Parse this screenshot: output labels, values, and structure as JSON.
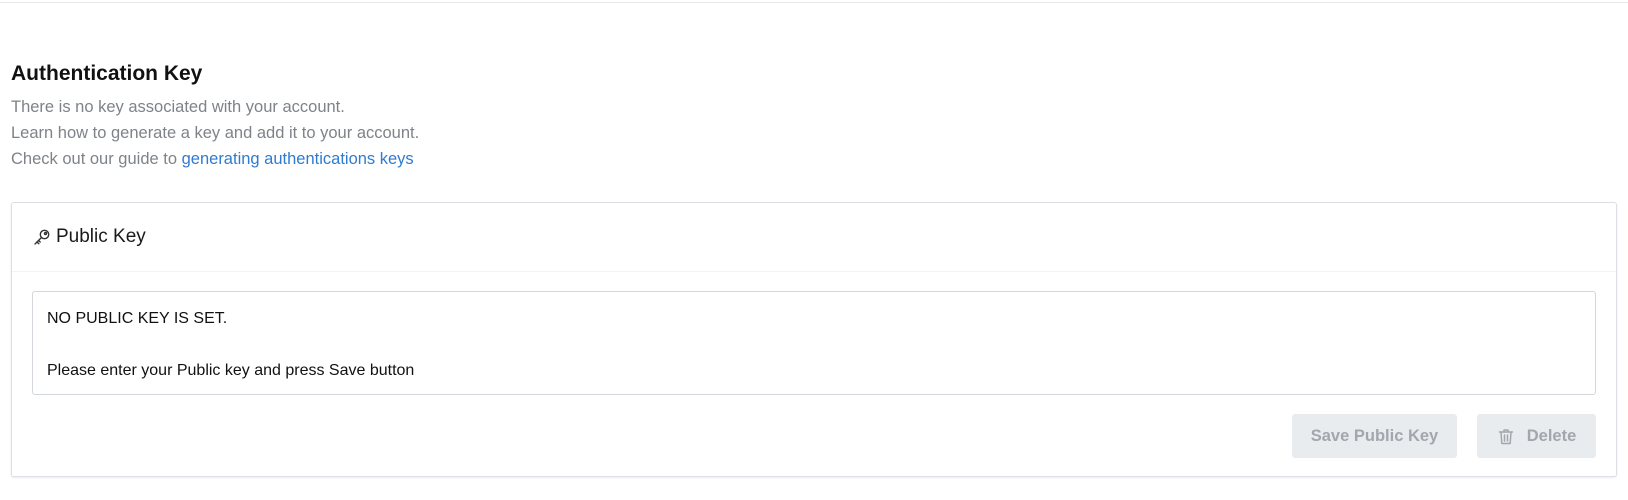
{
  "section": {
    "title": "Authentication Key",
    "lines": [
      "There is no key associated with your account.",
      "Learn how to generate a key and add it to your account."
    ],
    "guide_prefix": "Check out our guide to ",
    "guide_link": "generating authentications keys"
  },
  "card": {
    "title": "Public Key",
    "icon": "key-icon",
    "key_text_line1": "NO PUBLIC KEY IS SET.",
    "key_text_line2": "Please enter your Public key and press Save button",
    "save_label": "Save Public Key",
    "delete_label": "Delete",
    "delete_icon": "trash-icon"
  },
  "colors": {
    "link": "#2f7bd1",
    "muted_text": "#7e8389",
    "button_bg": "#e9ecef",
    "button_text": "#a2a7ad"
  }
}
